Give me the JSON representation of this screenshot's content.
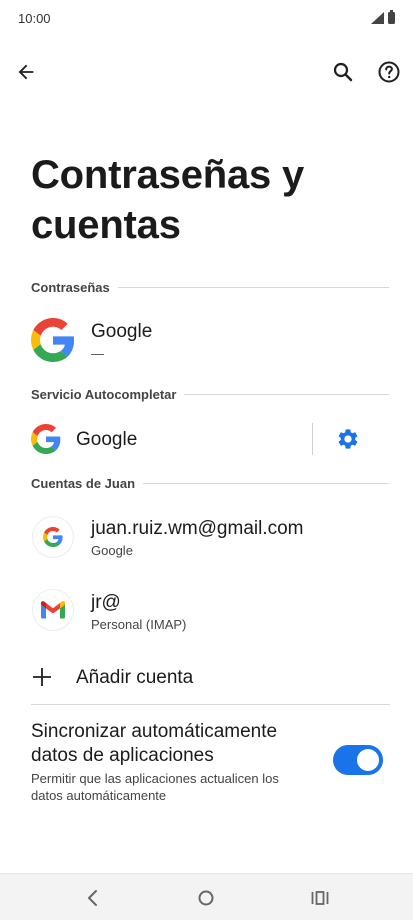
{
  "status_bar": {
    "time": "10:00"
  },
  "page": {
    "title": "Contraseñas y cuentas"
  },
  "sections": {
    "passwords": "Contraseñas",
    "autofill": "Servicio Autocompletar",
    "accounts": "Cuentas de Juan"
  },
  "passwords_item": {
    "name": "Google",
    "sub": "—"
  },
  "autofill_item": {
    "name": "Google"
  },
  "accounts": [
    {
      "email": "juan.ruiz.wm@gmail.com",
      "type": "Google",
      "icon": "google-icon"
    },
    {
      "email": "jr@",
      "type": "Personal (IMAP)",
      "icon": "gmail-icon"
    }
  ],
  "add_account": {
    "label": "Añadir cuenta"
  },
  "sync": {
    "title": "Sincronizar automáticamente datos de aplicaciones",
    "description": "Permitir que las aplicaciones actualicen los datos automáticamente",
    "enabled": true
  },
  "colors": {
    "accent": "#1a73e8"
  },
  "icons": [
    "back-arrow-icon",
    "search-icon",
    "help-icon",
    "google-icon",
    "gear-icon",
    "gmail-icon",
    "plus-icon",
    "nav-back-icon",
    "nav-home-icon",
    "nav-recents-icon"
  ]
}
